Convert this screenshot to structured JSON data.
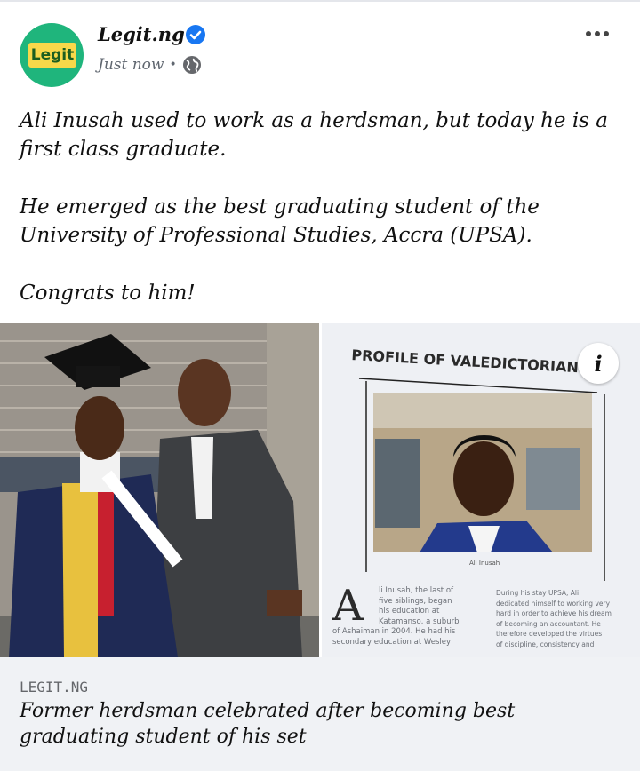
{
  "post": {
    "page_name": "Legit.ng",
    "avatar_text": "Legit",
    "timestamp": "Just now",
    "separator": "•",
    "paragraphs": [
      "Ali Inusah used to work as a herdsman, but today he is a first class graduate.",
      "He emerged as the best graduating student of the University of Professional Studies, Accra (UPSA).",
      "Congrats to him!"
    ]
  },
  "photo_right": {
    "heading": "PROFILE OF VALEDICTORIAN",
    "caption": "Ali Inusah",
    "drop_cap": "A",
    "col1": [
      "li Inusah, the last of",
      "five siblings, began",
      "his education at",
      "Katamanso, a suburb",
      "of Ashaiman in 2004. He had his",
      "secondary education at Wesley"
    ],
    "col2": [
      "During his stay UPSA, Ali",
      "dedicated himself to working very",
      "hard in order to achieve his dream",
      "of becoming an accountant. He",
      "therefore developed the virtues",
      "of discipline, consistency and"
    ]
  },
  "info_button": "i",
  "link": {
    "domain": "LEGIT.NG",
    "title": "Former herdsman celebrated after becoming best graduating student of his set"
  },
  "colors": {
    "avatar_bg": "#1fb57c",
    "avatar_badge": "#f8d84a",
    "verified": "#1877f2",
    "link_card_bg": "#f0f2f5"
  },
  "icons": [
    "verified-badge-icon",
    "globe-icon",
    "more-options-icon",
    "info-icon"
  ]
}
